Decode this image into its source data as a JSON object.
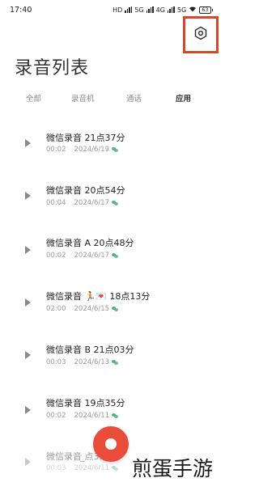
{
  "status_bar": {
    "time": "17:40",
    "network_labels": [
      "HD",
      "5G",
      "4G",
      "5G"
    ],
    "battery": "63"
  },
  "page_title": "录音列表",
  "tabs": [
    {
      "label": "全部",
      "active": false
    },
    {
      "label": "录音机",
      "active": false
    },
    {
      "label": "通话",
      "active": false
    },
    {
      "label": "应用",
      "active": true
    }
  ],
  "recordings": [
    {
      "title": "微信录音  21点37分",
      "duration": "00:02",
      "date": "2024/6/19"
    },
    {
      "title": "微信录音  20点54分",
      "duration": "00:04",
      "date": "2024/6/17"
    },
    {
      "title": "微信录音 A 20点48分",
      "duration": "00:02",
      "date": "2024/6/17"
    },
    {
      "title": "微信录音 🏃💌 18点13分",
      "duration": "02:00",
      "date": "2024/6/15"
    },
    {
      "title": "微信录音 B 21点03分",
      "duration": "00:03",
      "date": "2024/6/13"
    },
    {
      "title": "微信录音  19点35分",
      "duration": "00:02",
      "date": "2024/6/11"
    },
    {
      "title": "微信录音  ̲点33分",
      "duration": "00:03",
      "date": "2024/6/11"
    }
  ],
  "icons": {
    "settings": "gear-icon",
    "play": "play-icon",
    "wechat": "wechat-icon",
    "record": "record-icon"
  },
  "colors": {
    "accent": "#ea4c3c",
    "highlight_box": "#d24a2c",
    "wechat_green": "#4fb37a"
  },
  "watermark": "煎蛋手游"
}
